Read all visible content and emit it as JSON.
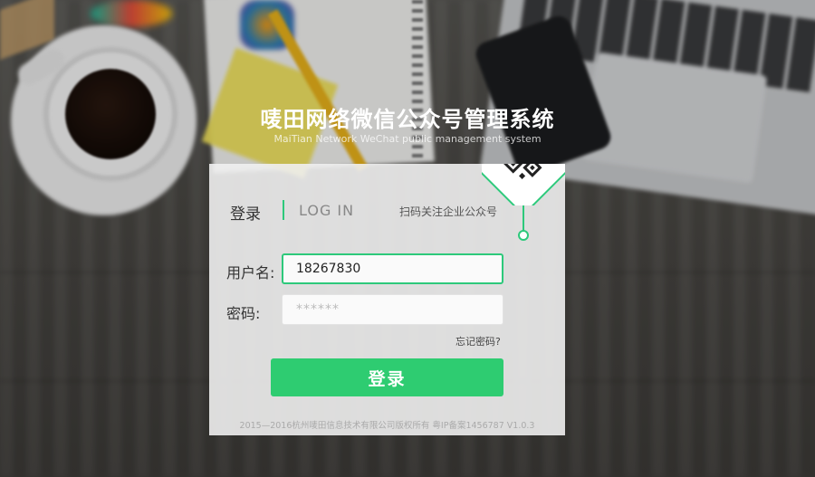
{
  "header": {
    "title": "唛田网络微信公众号管理系统",
    "subtitle": "MaiTian Network WeChat public management system"
  },
  "login": {
    "tab_label_cn": "登录",
    "tab_label_en": "LOG IN",
    "scan_prompt": "扫码关注企业公众号",
    "username_label": "用户名:",
    "username_value": "18267830",
    "password_label": "密码:",
    "password_placeholder": "******",
    "forgot_password": "忘记密码?",
    "submit_label": "登录"
  },
  "footer": {
    "copyright": "2015—2016杭州唛田信息技术有限公司版权所有    粤IP备案1456787 V1.0.3"
  },
  "colors": {
    "accent": "#2ecc71",
    "panel_bg": "#f0f0f0"
  },
  "icons": {
    "qr_corner": "qr-code-icon"
  }
}
